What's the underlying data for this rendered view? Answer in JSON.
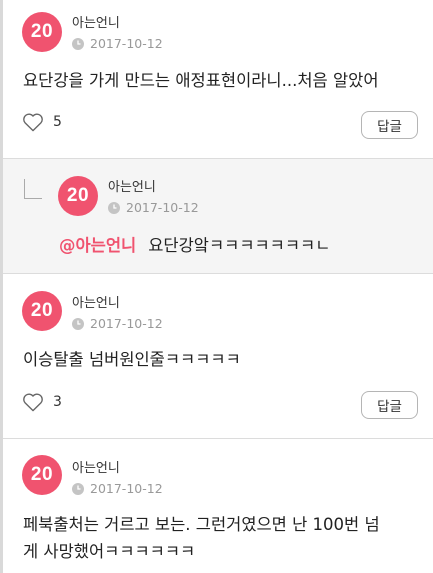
{
  "comments": [
    {
      "avatar_text": "20",
      "author": "아는언니",
      "date": "2017-10-12",
      "text": "요단강을 가게 만드는 애정표현이라니...처음 알았어",
      "likes": "5",
      "reply_label": "답글"
    },
    {
      "avatar_text": "20",
      "author": "아는언니",
      "date": "2017-10-12",
      "text": "이승탈출 넘버원인줄ㅋㅋㅋㅋㅋ",
      "likes": "3",
      "reply_label": "답글"
    },
    {
      "avatar_text": "20",
      "author": "아는언니",
      "date": "2017-10-12",
      "text_line1": "페북출처는 거르고 보는. 그런거였으면 난 100번 넘",
      "text_line2": "게 사망했어ㅋㅋㅋㅋㅋㅋ"
    }
  ],
  "reply": {
    "avatar_text": "20",
    "author": "아는언니",
    "date": "2017-10-12",
    "mention": "@아는언니",
    "text": "요단강앜ㅋㅋㅋㅋㅋㅋㅋㄴ"
  },
  "colors": {
    "accent": "#f0536f",
    "muted": "#999999",
    "reply_bg": "#f5f5f5"
  },
  "icons": {
    "like": "heart-outline-icon",
    "time": "clock-icon",
    "reply_indicator": "reply-arrow-icon"
  }
}
